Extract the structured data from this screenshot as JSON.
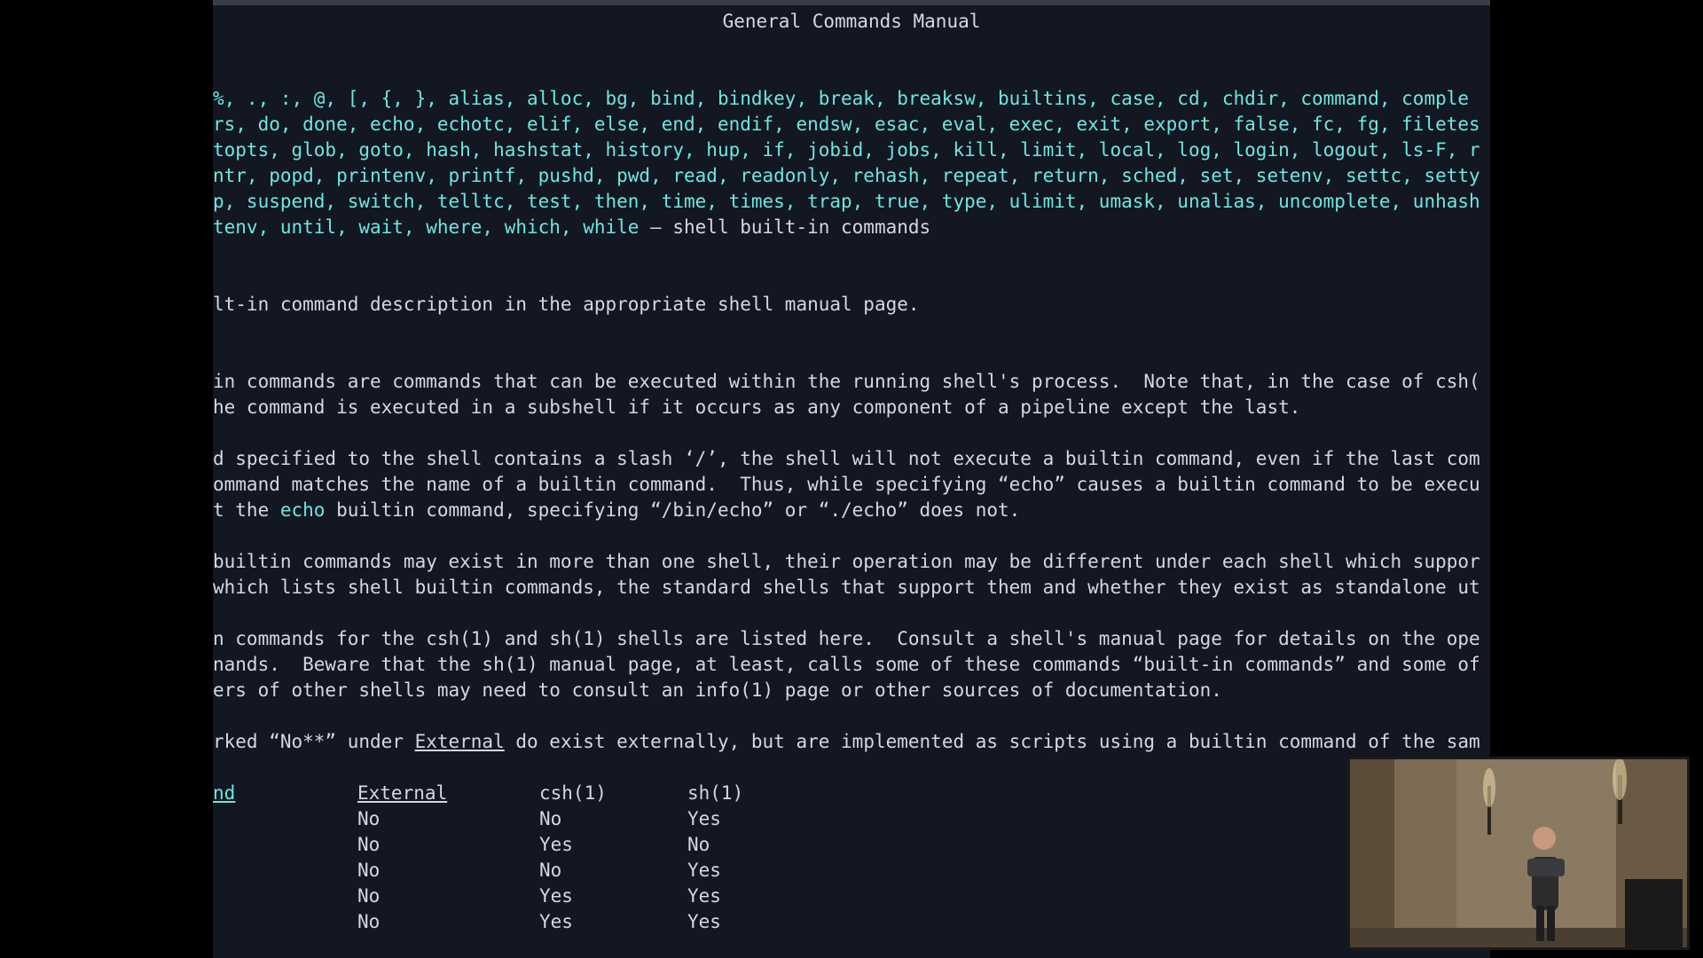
{
  "manual": {
    "header": "General Commands Manual",
    "name_lines": [
      "%, ., :, @, [, {, }, alias, alloc, bg, bind, bindkey, break, breaksw, builtins, case, cd, chdir, command, comple",
      "rs, do, done, echo, echotc, elif, else, end, endif, endsw, esac, eval, exec, exit, export, false, fc, fg, filetes",
      "topts, glob, goto, hash, hashstat, history, hup, if, jobid, jobs, kill, limit, local, log, login, logout, ls-F, r",
      "ntr, popd, printenv, printf, pushd, pwd, read, readonly, rehash, repeat, return, sched, set, setenv, settc, setty",
      "p, suspend, switch, telltc, test, then, time, times, trap, true, type, ulimit, umask, unalias, uncomplete, unhash"
    ],
    "name_last_cmds": "tenv, until, wait, where, which, while",
    "name_last_desc": " – shell built-in commands",
    "synopsis": "lt-in command description in the appropriate shell manual page.",
    "desc_p1": [
      "in commands are commands that can be executed within the running shell's process.  Note that, in the case of csh(",
      "he command is executed in a subshell if it occurs as any component of a pipeline except the last."
    ],
    "desc_p2": [
      "d specified to the shell contains a slash ‘/’, the shell will not execute a builtin command, even if the last com",
      "ommand matches the name of a builtin command.  Thus, while specifying “echo” causes a builtin command to be execu"
    ],
    "desc_p2_last": {
      "before": "t the ",
      "echo": "echo",
      "after": " builtin command, specifying “/bin/echo” or “./echo” does not."
    },
    "desc_p3": [
      "builtin commands may exist in more than one shell, their operation may be different under each shell which suppor",
      "which lists shell builtin commands, the standard shells that support them and whether they exist as standalone ut"
    ],
    "desc_p4": [
      "n commands for the csh(1) and sh(1) shells are listed here.  Consult a shell's manual page for details on the ope",
      "nands.  Beware that the sh(1) manual page, at least, calls some of these commands “built-in commands” and some of",
      "ers of other shells may need to consult an info(1) page or other sources of documentation."
    ],
    "desc_p5": {
      "before": "rked “No**” under ",
      "external": "External",
      "after": " do exist externally, but are implemented as scripts using a builtin command of the sam"
    },
    "table": {
      "headers": [
        "nd",
        "External",
        "csh(1)",
        "sh(1)"
      ],
      "rows": [
        [
          "No",
          "No",
          "Yes"
        ],
        [
          "No",
          "Yes",
          "No"
        ],
        [
          "No",
          "No",
          "Yes"
        ],
        [
          "No",
          "Yes",
          "Yes"
        ],
        [
          "No",
          "Yes",
          "Yes"
        ]
      ]
    }
  },
  "colors": {
    "background": "#121722",
    "text": "#d4d8df",
    "highlight": "#6ee6e0"
  }
}
